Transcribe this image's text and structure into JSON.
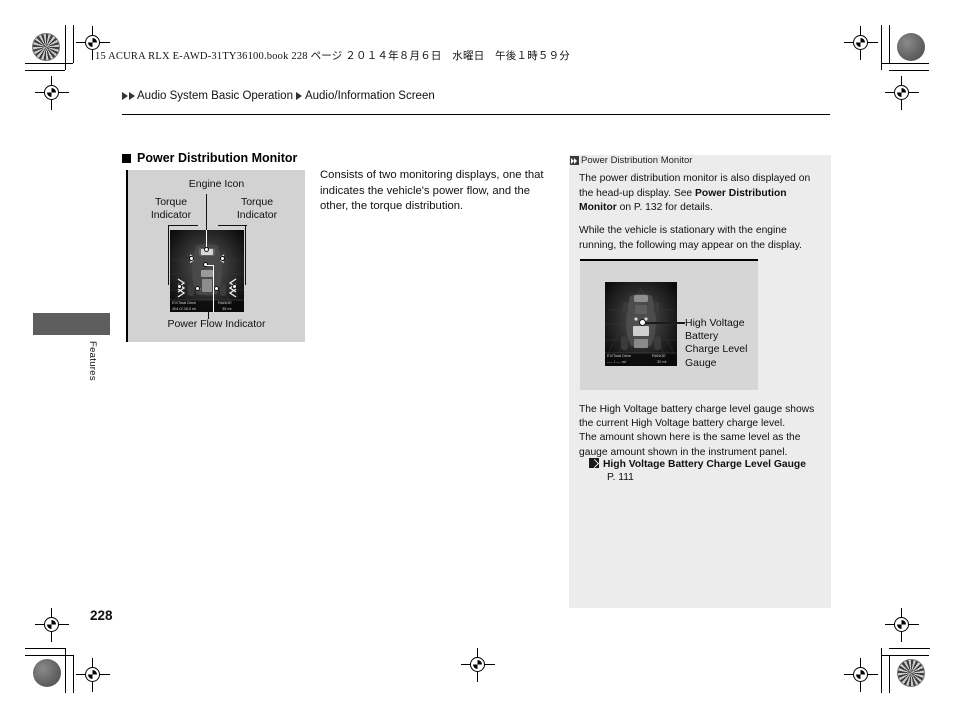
{
  "imprint": "15 ACURA RLX E-AWD-31TY36100.book  228 ページ  ２０１４年８月６日　水曜日　午後１時５９分",
  "breadcrumb": {
    "items": [
      "Audio System Basic Operation",
      "Audio/Information Screen"
    ]
  },
  "margin_tab": {
    "label": "Features"
  },
  "page_number": "228",
  "section": {
    "heading": "Power Distribution Monitor"
  },
  "figure_left": {
    "caption_engine": "Engine Icon",
    "caption_torque_left": "Torque\nIndicator",
    "caption_torque_left_line1": "Torque",
    "caption_torque_left_line2": "Indicator",
    "caption_torque_right_line1": "Torque",
    "caption_torque_right_line2": "Indicator",
    "caption_power_flow": "Power Flow Indicator",
    "display_labels": {
      "ev_total_drive": "EV/Total Drive",
      "ev_total_value": "404.0/ 28.0 mi",
      "range": "RANGE",
      "range_value": "35 mi"
    }
  },
  "body_text": "Consists of two monitoring displays, one that indicates the vehicle's power flow, and the other, the torque distribution.",
  "sidebar": {
    "heading": "Power Distribution Monitor",
    "paragraph_1_part_1": "The power distribution monitor is also displayed on the head-up display. See ",
    "paragraph_1_bold": "Power Distribution Monitor",
    "paragraph_1_part_2": " on  P. 132 for details.",
    "paragraph_2": "While the vehicle is stationary with the engine running, the following may appear on the display.",
    "figure_label": "High Voltage Battery Charge Level Gauge",
    "figure_label_lines": [
      "High Voltage",
      "Battery",
      "Charge Level",
      "Gauge"
    ],
    "figure_display_labels": {
      "ev_total_drive": "EV/Total Drive",
      "ev_total_value": "---.- / --.- mi",
      "range": "RANGE",
      "range_value": "32 mi"
    },
    "paragraph_3": "The High Voltage battery charge level gauge shows the current High Voltage battery charge level.\nThe amount shown here is the same level as the gauge amount shown in the instrument panel.",
    "paragraph_3_line_1": "The High Voltage battery charge level gauge shows",
    "paragraph_3_line_2": "the current High Voltage battery charge level.",
    "paragraph_3_line_3": "The amount shown here is the same level as the",
    "paragraph_3_line_4": "gauge amount shown in the instrument panel.",
    "reference_title": "High Voltage Battery Charge Level Gauge",
    "reference_page": "P. 111"
  },
  "colors": {
    "figure_panel_bg": "#d2d2d2",
    "sidebar_bg": "#ececec",
    "sidebar_figure_bg": "#d6d6d6",
    "margin_tab_bg": "#5e5e5e",
    "display_bg": "#141414",
    "text": "#111111"
  }
}
